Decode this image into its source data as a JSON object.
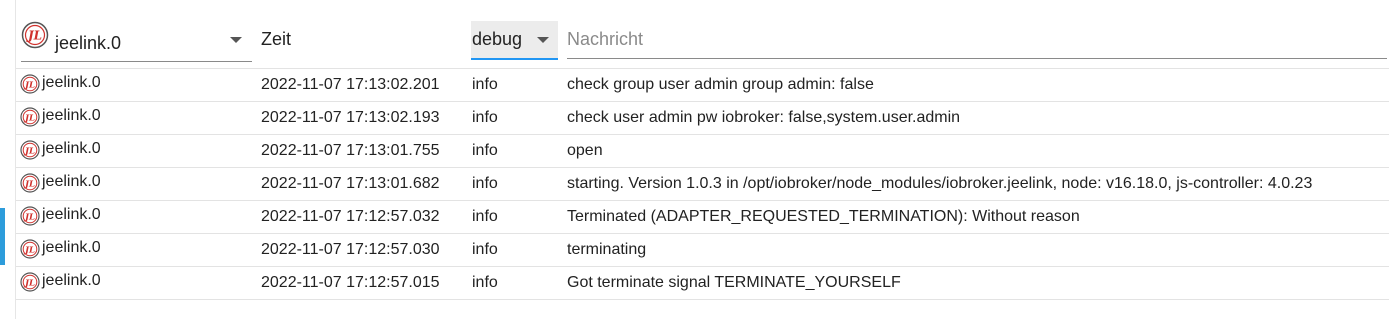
{
  "filter": {
    "adapter_value": "jeelink.0",
    "time_header": "Zeit",
    "level_value": "debug",
    "message_placeholder": "Nachricht",
    "logo_text": "JL"
  },
  "colors": {
    "accent": "#2196f3",
    "logo_red": "#d0312d",
    "left_marker": "#2d9cdb"
  },
  "rows": [
    {
      "source": "jeelink.0",
      "time": "2022-11-07 17:13:02.201",
      "level": "info",
      "message": "check group user admin group admin: false"
    },
    {
      "source": "jeelink.0",
      "time": "2022-11-07 17:13:02.193",
      "level": "info",
      "message": "check user admin pw iobroker: false,system.user.admin"
    },
    {
      "source": "jeelink.0",
      "time": "2022-11-07 17:13:01.755",
      "level": "info",
      "message": "open"
    },
    {
      "source": "jeelink.0",
      "time": "2022-11-07 17:13:01.682",
      "level": "info",
      "message": "starting. Version 1.0.3 in /opt/iobroker/node_modules/iobroker.jeelink, node: v16.18.0, js-controller: 4.0.23"
    },
    {
      "source": "jeelink.0",
      "time": "2022-11-07 17:12:57.032",
      "level": "info",
      "message": "Terminated (ADAPTER_REQUESTED_TERMINATION): Without reason"
    },
    {
      "source": "jeelink.0",
      "time": "2022-11-07 17:12:57.030",
      "level": "info",
      "message": "terminating"
    },
    {
      "source": "jeelink.0",
      "time": "2022-11-07 17:12:57.015",
      "level": "info",
      "message": "Got terminate signal TERMINATE_YOURSELF"
    }
  ]
}
